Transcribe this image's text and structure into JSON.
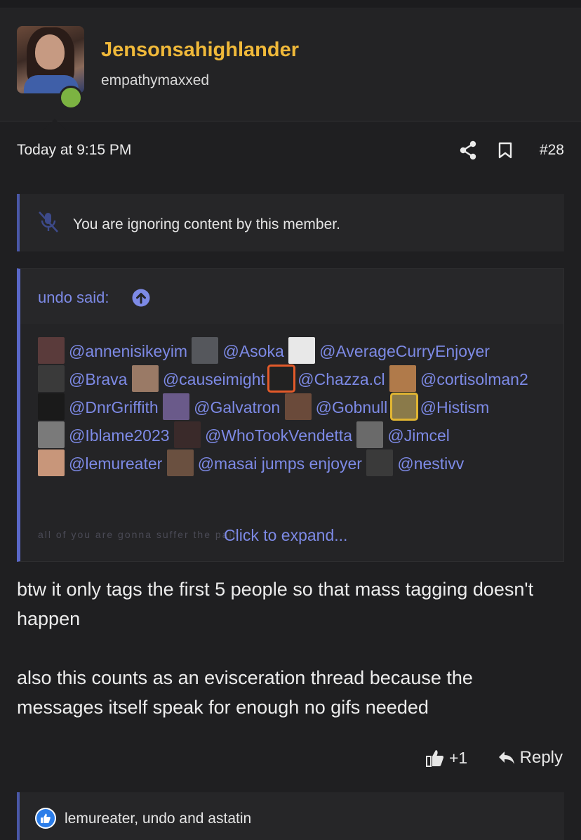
{
  "user": {
    "name": "Jensonsahighlander",
    "title": "empathymaxxed"
  },
  "post": {
    "time": "Today at 9:15 PM",
    "number": "#28"
  },
  "ignored": {
    "text": "You are ignoring content by this member."
  },
  "quote": {
    "author": "undo said:",
    "mentions": [
      {
        "text": "@annenisikeyim",
        "thumb": "#5a3b3b"
      },
      {
        "text": "@Asoka",
        "thumb": "#55575c"
      },
      {
        "text": "@AverageCurryEnjoyer",
        "thumb": "#e8e8e8"
      },
      {
        "text": "@Brava",
        "thumb": "#3a3a3a"
      },
      {
        "text": "@causeimight",
        "thumb": "#9a7a66"
      },
      {
        "text": "@Chazza.cl",
        "thumb": "#222222",
        "ring": "orange"
      },
      {
        "text": "@cortisolman2",
        "thumb": "#b07a4a"
      },
      {
        "text": "@DnrGriffith",
        "thumb": "#1a1a1a"
      },
      {
        "text": "@Galvatron",
        "thumb": "#6a5a8a"
      },
      {
        "text": "@Gobnull",
        "thumb": "#6a4a3a"
      },
      {
        "text": "@Histism",
        "thumb": "#8a7a4a",
        "ring": "gold"
      },
      {
        "text": "@Iblame2023",
        "thumb": "#7a7a7a"
      },
      {
        "text": "@WhoTookVendetta",
        "thumb": "#3a2a2a"
      },
      {
        "text": "@Jimcel",
        "thumb": "#6a6a6a"
      },
      {
        "text": "@lemureater",
        "thumb": "#c8967a"
      },
      {
        "text": "@masai jumps enjoyer",
        "thumb": "#6a5040"
      },
      {
        "text": "@nestivv",
        "thumb": "#3a3a3a"
      }
    ],
    "faded_text": "all of you are gonna suffer the pain",
    "expand": "Click to expand..."
  },
  "body": {
    "p1": "btw it only tags the first 5 people so that mass tagging doesn't happen",
    "p2": "also this counts as an evisceration thread because the messages itself speak for enough no gifs needed"
  },
  "actions": {
    "like": "+1",
    "reply": "Reply"
  },
  "reactions": {
    "text": "lemureater, undo and astatin"
  },
  "colors": {
    "username": "#f0b93a",
    "link": "#7d8ae6",
    "online": "#7cb342",
    "accent_border": "#5a68c8"
  }
}
